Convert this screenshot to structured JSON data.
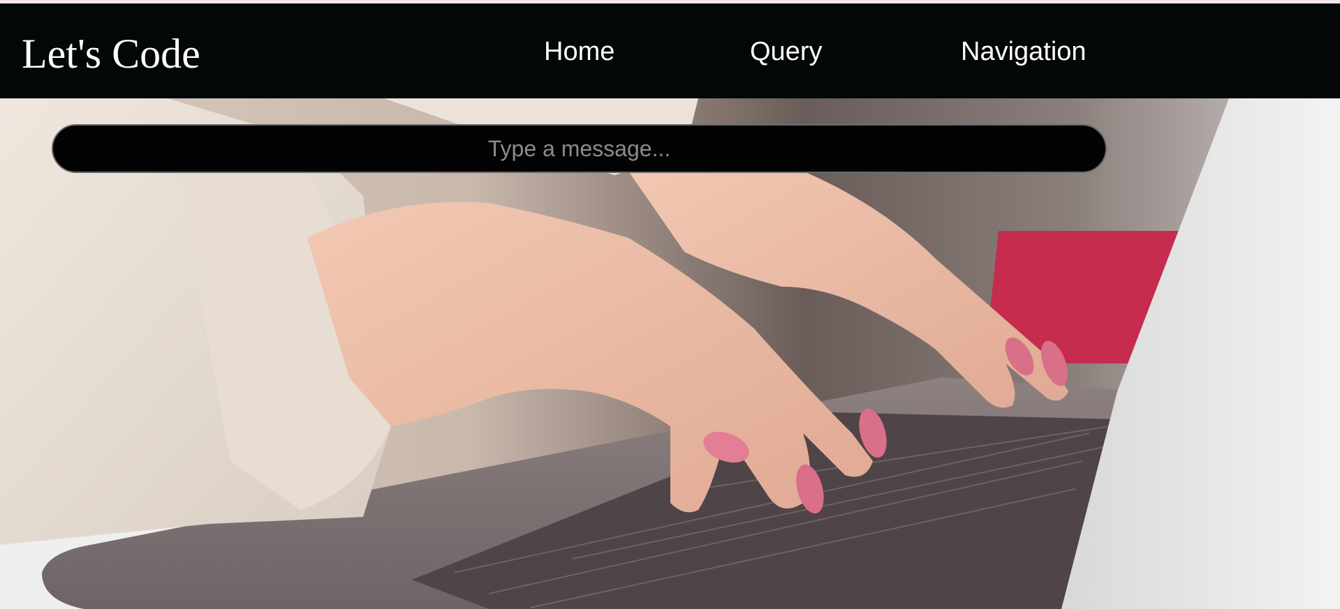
{
  "brand": {
    "title": "Let's Code"
  },
  "nav": {
    "items": [
      {
        "label": "Home"
      },
      {
        "label": "Query"
      },
      {
        "label": "Navigation"
      }
    ]
  },
  "message": {
    "placeholder": "Type a message..."
  },
  "hero": {
    "image": "hands-typing-on-laptop"
  },
  "colors": {
    "navbar": "#030708",
    "nav_text": "#ffffff",
    "top_strip": "#f3e4e6",
    "input_bg": "#030303",
    "placeholder": "#8c8c8c"
  }
}
